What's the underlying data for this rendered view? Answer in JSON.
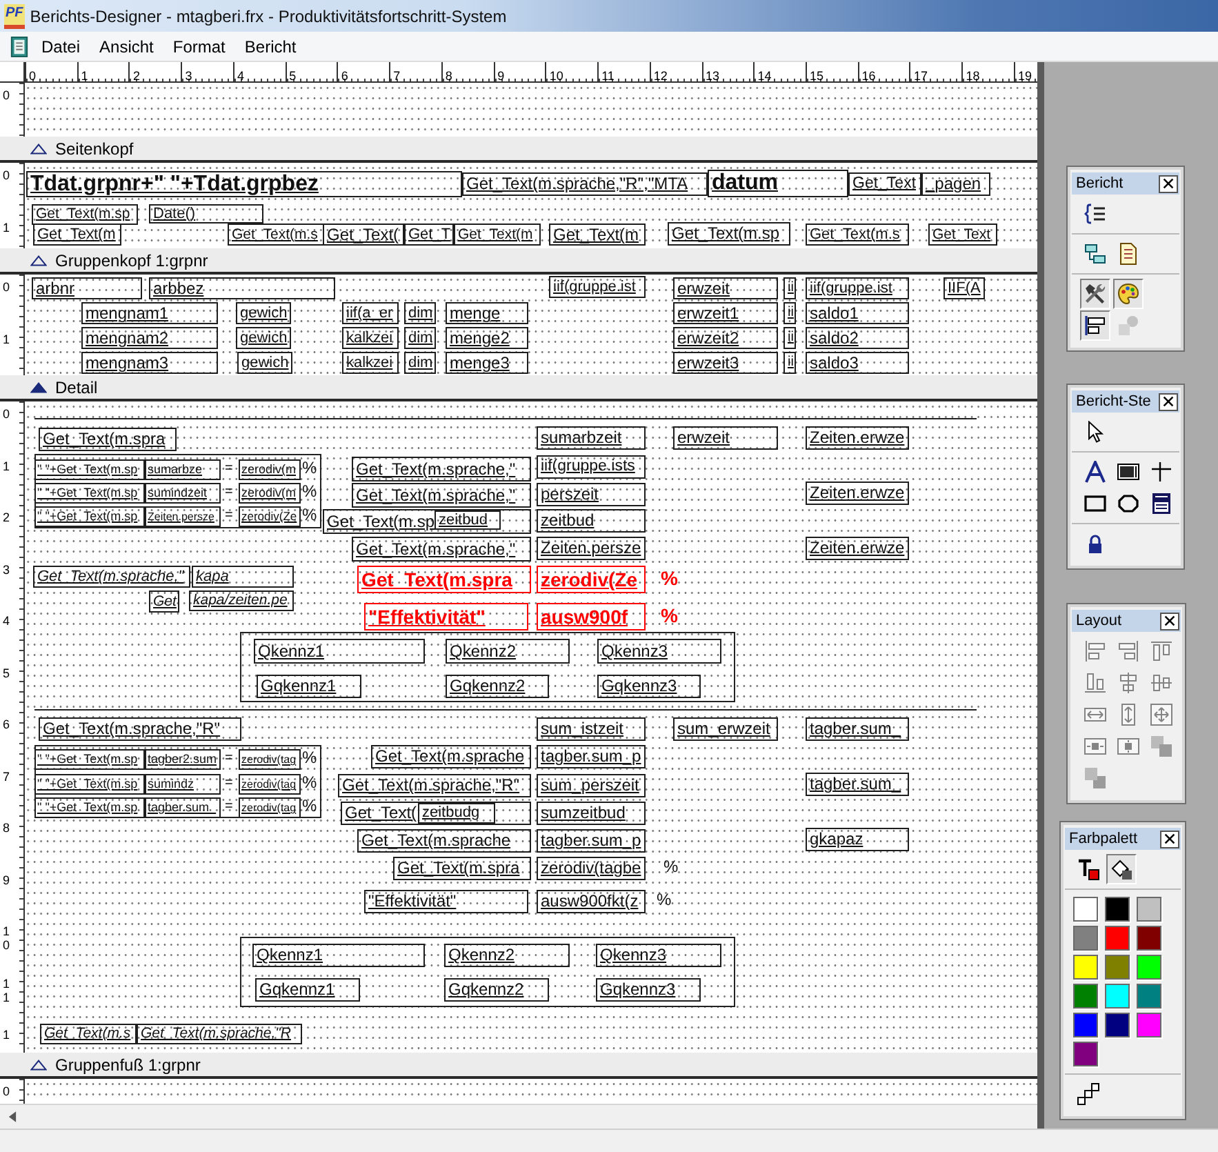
{
  "window": {
    "logo": "PF",
    "title": "Berichts-Designer - mtagberi.frx - Produktivitätsfortschritt-System"
  },
  "menu": [
    {
      "label": "Datei"
    },
    {
      "label": "Ansicht"
    },
    {
      "label": "Format"
    },
    {
      "label": "Bericht"
    }
  ],
  "ruler": [
    "0",
    "1",
    "2",
    "3",
    "4",
    "5",
    "6",
    "7",
    "8",
    "9",
    "10",
    "11",
    "12",
    "13",
    "14",
    "15",
    "16",
    "17",
    "18",
    "19"
  ],
  "bands": [
    {
      "ruler": [
        "0"
      ],
      "bar": {
        "label": "Seitenkopf",
        "selected": false
      }
    },
    {
      "ruler": [
        "0",
        "1"
      ],
      "fields": [
        {
          "text": "Tdat.grpnr+\" \"+Tdat.grpbez",
          "kind": "title"
        },
        {
          "text": "Get_Text(m.sprache,\"R\",\"MTA",
          "kind": "field"
        },
        {
          "text": "datum",
          "kind": "title"
        },
        {
          "text": "Get_Text",
          "kind": "field"
        },
        {
          "text": "_pagen",
          "kind": "field"
        },
        {
          "text": "Get_Text(m.sp",
          "kind": "field"
        },
        {
          "text": "Date()",
          "kind": "field"
        },
        {
          "text": "Get_Text(m",
          "kind": "field"
        },
        {
          "text": "Get_Text(m.s",
          "kind": "field"
        },
        {
          "text": "Get_Text(",
          "kind": "field"
        },
        {
          "text": "Get_T",
          "kind": "field"
        },
        {
          "text": "Get_Text(m",
          "kind": "field"
        },
        {
          "text": "Get_Text(m",
          "kind": "field"
        },
        {
          "text": "Get_Text(m.sp",
          "kind": "field"
        },
        {
          "text": "Get_Text(m.s",
          "kind": "field"
        },
        {
          "text": "Get_Text",
          "kind": "field"
        }
      ],
      "bar": {
        "label": "Gruppenkopf 1:grpnr",
        "selected": false
      }
    },
    {
      "ruler": [
        "0",
        "1"
      ],
      "fields": [
        {
          "text": "arbnr",
          "kind": "field"
        },
        {
          "text": "arbbez",
          "kind": "field"
        },
        {
          "text": "iif(gruppe.ist",
          "kind": "field"
        },
        {
          "text": "erwzeit",
          "kind": "field"
        },
        {
          "text": "ii",
          "kind": "field"
        },
        {
          "text": "iif(gruppe.ist",
          "kind": "field"
        },
        {
          "text": "IIF(A",
          "kind": "field"
        },
        {
          "text": "mengnam1",
          "kind": "field"
        },
        {
          "text": "gewich",
          "kind": "field"
        },
        {
          "text": "iif(a_er",
          "kind": "field"
        },
        {
          "text": "dim",
          "kind": "field"
        },
        {
          "text": "menge",
          "kind": "field"
        },
        {
          "text": "erwzeit1",
          "kind": "field"
        },
        {
          "text": "ii",
          "kind": "field"
        },
        {
          "text": "saldo1",
          "kind": "field"
        },
        {
          "text": "mengnam2",
          "kind": "field"
        },
        {
          "text": "gewich",
          "kind": "field"
        },
        {
          "text": "kalkzei",
          "kind": "field"
        },
        {
          "text": "dim",
          "kind": "field"
        },
        {
          "text": "menge2",
          "kind": "field"
        },
        {
          "text": "erwzeit2",
          "kind": "field"
        },
        {
          "text": "ii",
          "kind": "field"
        },
        {
          "text": "saldo2",
          "kind": "field"
        },
        {
          "text": "mengnam3",
          "kind": "field"
        },
        {
          "text": "gewich",
          "kind": "field"
        },
        {
          "text": "kalkzei",
          "kind": "field"
        },
        {
          "text": "dim",
          "kind": "field"
        },
        {
          "text": "menge3",
          "kind": "field"
        },
        {
          "text": "erwzeit3",
          "kind": "field"
        },
        {
          "text": "ii",
          "kind": "field"
        },
        {
          "text": "saldo3",
          "kind": "field"
        }
      ],
      "bar": {
        "label": "Detail",
        "selected": true
      }
    },
    {
      "ruler": [
        "0",
        "1",
        "2",
        "3",
        "4",
        "5",
        "6",
        "7",
        "8",
        "9",
        "10",
        "11",
        "1"
      ],
      "fields": [
        {
          "text": "Get_Text(m.spra",
          "kind": "field"
        },
        {
          "text": "sumarbzeit",
          "kind": "field"
        },
        {
          "text": "erwzeit",
          "kind": "field"
        },
        {
          "text": "Zeiten.erwze",
          "kind": "field"
        },
        {
          "text": "\" \"+Get_Text(m.sp",
          "kind": "small"
        },
        {
          "text": "sumarbze",
          "kind": "small"
        },
        {
          "text": "=",
          "kind": "label"
        },
        {
          "text": "zerodiv(m",
          "kind": "small"
        },
        {
          "text": "%",
          "kind": "label"
        },
        {
          "text": "\" \"+Get_Text(m.sp",
          "kind": "small"
        },
        {
          "text": "sumindzeit",
          "kind": "small"
        },
        {
          "text": "=",
          "kind": "label"
        },
        {
          "text": "zerodiv(m",
          "kind": "small"
        },
        {
          "text": "%",
          "kind": "label"
        },
        {
          "text": "\" \"+Get_Text(m.sp",
          "kind": "small"
        },
        {
          "text": "Zeiten.persze",
          "kind": "small"
        },
        {
          "text": "=",
          "kind": "label"
        },
        {
          "text": "zerodiv(Ze",
          "kind": "small"
        },
        {
          "text": "%",
          "kind": "label"
        },
        {
          "text": "Get_Text(m.sprache,\"",
          "kind": "field"
        },
        {
          "text": "iif(gruppe.ists",
          "kind": "field"
        },
        {
          "text": "Get_Text(m.sprache,\"",
          "kind": "field"
        },
        {
          "text": "perszeit",
          "kind": "field"
        },
        {
          "text": "Zeiten.erwze",
          "kind": "field"
        },
        {
          "text": "Get_Text(m.sp",
          "kind": "field"
        },
        {
          "text": "zeitbud",
          "kind": "field"
        },
        {
          "text": "zeitbud",
          "kind": "field"
        },
        {
          "text": "Get_Text(m.sprache,\"",
          "kind": "field"
        },
        {
          "text": "Zeiten.persze",
          "kind": "field"
        },
        {
          "text": "Zeiten.erwze",
          "kind": "field"
        },
        {
          "text": "Get_Text(m.spra",
          "kind": "highlight",
          "color": "#ff0000"
        },
        {
          "text": "zerodiv(Ze",
          "kind": "highlight",
          "color": "#ff0000"
        },
        {
          "text": "%",
          "kind": "highlight_label",
          "color": "#ff0000"
        },
        {
          "text": "\"Effektivität\"",
          "kind": "highlight",
          "color": "#ff0000"
        },
        {
          "text": "ausw900f",
          "kind": "highlight",
          "color": "#ff0000"
        },
        {
          "text": "%",
          "kind": "highlight_label",
          "color": "#ff0000"
        },
        {
          "text": "Get_Text(m.sprache,\"",
          "kind": "note"
        },
        {
          "text": "kapa",
          "kind": "note"
        },
        {
          "text": "Get",
          "kind": "note"
        },
        {
          "text": "kapa/zeiten.pe",
          "kind": "note"
        },
        {
          "text": "Qkennz1",
          "kind": "field"
        },
        {
          "text": "Qkennz2",
          "kind": "field"
        },
        {
          "text": "Qkennz3",
          "kind": "field"
        },
        {
          "text": "Gqkennz1",
          "kind": "field"
        },
        {
          "text": "Gqkennz2",
          "kind": "field"
        },
        {
          "text": "Gqkennz3",
          "kind": "field"
        },
        {
          "text": "Get_Text(m.sprache,\"R\"",
          "kind": "field"
        },
        {
          "text": "sum_istzeit",
          "kind": "field"
        },
        {
          "text": "sum_erwzeit",
          "kind": "field"
        },
        {
          "text": "tagber.sum_",
          "kind": "field"
        },
        {
          "text": "\" \"+Get_Text(m.sp",
          "kind": "small"
        },
        {
          "text": "tagber2.sum",
          "kind": "small"
        },
        {
          "text": "=",
          "kind": "label"
        },
        {
          "text": "zerodiv(tag",
          "kind": "small"
        },
        {
          "text": "%",
          "kind": "label"
        },
        {
          "text": "\" \"+Get_Text(m.sp",
          "kind": "small"
        },
        {
          "text": "sumindz",
          "kind": "small"
        },
        {
          "text": "=",
          "kind": "label"
        },
        {
          "text": "zerodiv(tag",
          "kind": "small"
        },
        {
          "text": "%",
          "kind": "label"
        },
        {
          "text": "\" \"+Get_Text(m.sp",
          "kind": "small"
        },
        {
          "text": "tagber.sum_",
          "kind": "small"
        },
        {
          "text": "=",
          "kind": "label"
        },
        {
          "text": "zerodiv(tag",
          "kind": "small"
        },
        {
          "text": "%",
          "kind": "label"
        },
        {
          "text": "Get_Text(m.sprache",
          "kind": "field"
        },
        {
          "text": "tagber.sum_p",
          "kind": "field"
        },
        {
          "text": "Get_Text(m.sprache,\"R\"",
          "kind": "field"
        },
        {
          "text": "sum_perszeit",
          "kind": "field"
        },
        {
          "text": "tagber.sum_",
          "kind": "field"
        },
        {
          "text": "Get_Text(",
          "kind": "field"
        },
        {
          "text": "zeitbudg",
          "kind": "field"
        },
        {
          "text": "sumzeitbud",
          "kind": "field"
        },
        {
          "text": "Get_Text(m.sprache",
          "kind": "field"
        },
        {
          "text": "tagber.sum_p",
          "kind": "field"
        },
        {
          "text": "gkapaz",
          "kind": "field"
        },
        {
          "text": "Get_Text(m.spra",
          "kind": "field"
        },
        {
          "text": "zerodiv(tagbe",
          "kind": "field"
        },
        {
          "text": "%",
          "kind": "label"
        },
        {
          "text": "\"Effektivität\"",
          "kind": "field"
        },
        {
          "text": "ausw900fkt(z",
          "kind": "field"
        },
        {
          "text": "%",
          "kind": "label"
        },
        {
          "text": "Qkennz1",
          "kind": "field"
        },
        {
          "text": "Qkennz2",
          "kind": "field"
        },
        {
          "text": "Qkennz3",
          "kind": "field"
        },
        {
          "text": "Gqkennz1",
          "kind": "field"
        },
        {
          "text": "Gqkennz2",
          "kind": "field"
        },
        {
          "text": "Gqkennz3",
          "kind": "field"
        },
        {
          "text": "Get_Text(m.s",
          "kind": "note"
        },
        {
          "text": "Get_Text(m.sprache,\"R",
          "kind": "note"
        }
      ],
      "bar": {
        "label": "Gruppenfuß 1:grpnr",
        "selected": false
      }
    },
    {
      "ruler": [
        "0"
      ]
    }
  ],
  "toolbars": [
    {
      "title": "Bericht",
      "sections": [
        {
          "kind": "buttons",
          "buttons": [
            {
              "pressed": false,
              "disabled": false
            }
          ]
        },
        {
          "kind": "buttons",
          "buttons": [
            {
              "pressed": false,
              "disabled": false
            },
            {
              "pressed": false,
              "disabled": false
            }
          ]
        },
        {
          "kind": "buttons",
          "buttons": [
            {
              "pressed": true,
              "disabled": false
            },
            {
              "pressed": true,
              "disabled": false
            },
            {
              "pressed": true,
              "disabled": false
            },
            {
              "pressed": false,
              "disabled": true
            }
          ]
        }
      ]
    },
    {
      "title": "Bericht-Ste",
      "sections": [
        {
          "kind": "buttons",
          "buttons": [
            {
              "pressed": false,
              "disabled": false
            }
          ]
        },
        {
          "kind": "buttons",
          "buttons": [
            {
              "pressed": false,
              "disabled": false
            },
            {
              "pressed": false,
              "disabled": false
            },
            {
              "pressed": false,
              "disabled": false
            },
            {
              "pressed": false,
              "disabled": false
            },
            {
              "pressed": false,
              "disabled": false
            },
            {
              "pressed": false,
              "disabled": false
            }
          ]
        },
        {
          "kind": "buttons",
          "buttons": [
            {
              "pressed": false,
              "disabled": false
            }
          ]
        }
      ]
    },
    {
      "title": "Layout",
      "sections": [
        {
          "kind": "buttons",
          "buttons": [
            {
              "pressed": false,
              "disabled": true
            },
            {
              "pressed": false,
              "disabled": true
            },
            {
              "pressed": false,
              "disabled": true
            },
            {
              "pressed": false,
              "disabled": true
            },
            {
              "pressed": false,
              "disabled": true
            },
            {
              "pressed": false,
              "disabled": true
            },
            {
              "pressed": false,
              "disabled": true
            },
            {
              "pressed": false,
              "disabled": true
            },
            {
              "pressed": false,
              "disabled": true
            },
            {
              "pressed": false,
              "disabled": true
            },
            {
              "pressed": false,
              "disabled": true
            },
            {
              "pressed": false,
              "disabled": true
            },
            {
              "pressed": false,
              "disabled": true
            }
          ]
        }
      ]
    },
    {
      "title": "Farbpalett",
      "sections": [
        {
          "kind": "buttons",
          "buttons": [
            {
              "pressed": false,
              "disabled": false
            },
            {
              "pressed": true,
              "disabled": false
            }
          ]
        },
        {
          "kind": "swatches",
          "swatches": [
            {
              "color": "#ffffff"
            },
            {
              "color": "#000000"
            },
            {
              "color": "#c0c0c0"
            },
            {
              "color": "#808080"
            },
            {
              "color": "#ff0000"
            },
            {
              "color": "#800000"
            },
            {
              "color": "#ffff00"
            },
            {
              "color": "#808000"
            },
            {
              "color": "#00ff00"
            },
            {
              "color": "#008000"
            },
            {
              "color": "#00ffff"
            },
            {
              "color": "#008080"
            },
            {
              "color": "#0000ff"
            },
            {
              "color": "#000080"
            },
            {
              "color": "#ff00ff"
            },
            {
              "color": "#800080"
            }
          ]
        },
        {
          "kind": "buttons",
          "buttons": [
            {
              "pressed": false,
              "disabled": false
            }
          ]
        }
      ]
    }
  ]
}
